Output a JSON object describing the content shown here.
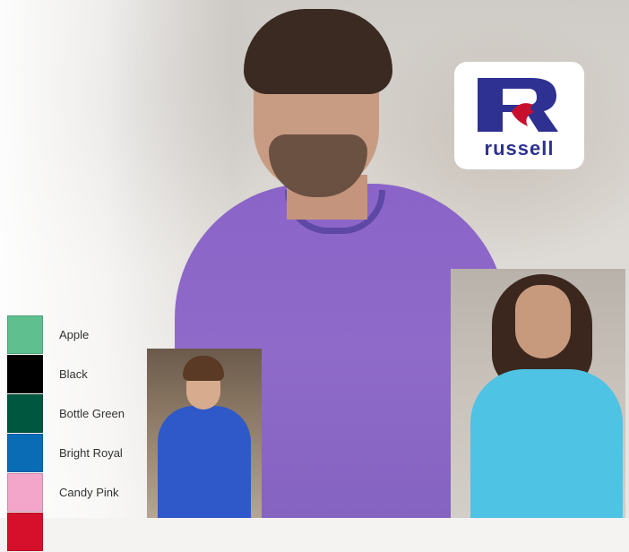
{
  "brand": {
    "logo_text": "russell",
    "colors": {
      "blue": "#2e3192",
      "red": "#c8102e"
    }
  },
  "photos": {
    "main": "man-in-purple-tshirt",
    "kid": "boy-in-royal-blue-tshirt",
    "woman": "woman-in-turquoise-tshirt"
  },
  "swatches": [
    {
      "label": "Apple",
      "color": "#5fbf8f"
    },
    {
      "label": "Black",
      "color": "#000000"
    },
    {
      "label": "Bottle Green",
      "color": "#00573f"
    },
    {
      "label": "Bright Royal",
      "color": "#0a6cb5"
    },
    {
      "label": "Candy Pink",
      "color": "#f3a6c9"
    },
    {
      "label": "",
      "color": "#d6102b"
    }
  ]
}
